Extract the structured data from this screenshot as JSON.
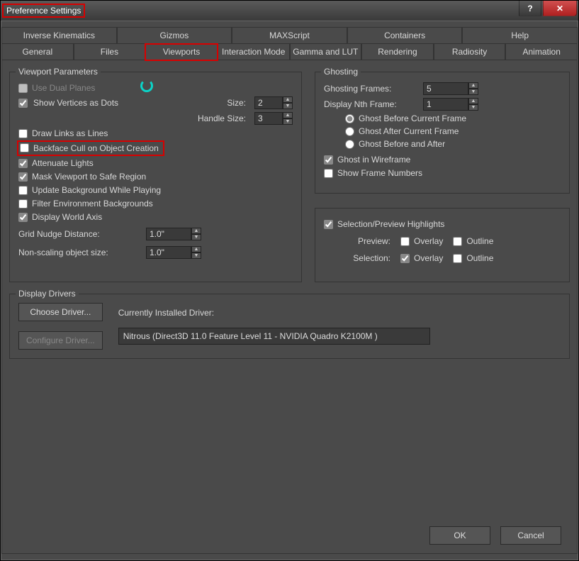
{
  "window": {
    "title": "Preference Settings"
  },
  "tabs_row1": [
    "Inverse Kinematics",
    "Gizmos",
    "MAXScript",
    "Containers",
    "Help"
  ],
  "tabs_row2": [
    "General",
    "Files",
    "Viewports",
    "Interaction Mode",
    "Gamma and LUT",
    "Rendering",
    "Radiosity",
    "Animation"
  ],
  "active_tab": "Viewports",
  "viewport_params": {
    "title": "Viewport Parameters",
    "use_dual_planes": "Use Dual Planes",
    "show_vertices": "Show Vertices as Dots",
    "size_lbl": "Size:",
    "size_val": "2",
    "handle_size_lbl": "Handle Size:",
    "handle_size_val": "3",
    "draw_links": "Draw Links as Lines",
    "backface": "Backface Cull on Object Creation",
    "attenuate": "Attenuate Lights",
    "mask": "Mask Viewport to Safe Region",
    "update_bg": "Update Background While Playing",
    "filter_env": "Filter Environment Backgrounds",
    "display_axis": "Display World Axis",
    "grid_nudge_lbl": "Grid Nudge Distance:",
    "grid_nudge_val": "1.0\"",
    "nonscale_lbl": "Non-scaling object size:",
    "nonscale_val": "1.0\""
  },
  "ghosting": {
    "title": "Ghosting",
    "frames_lbl": "Ghosting Frames:",
    "frames_val": "5",
    "nth_lbl": "Display Nth Frame:",
    "nth_val": "1",
    "before": "Ghost Before Current Frame",
    "after": "Ghost After Current Frame",
    "both": "Ghost Before and After",
    "wire": "Ghost in Wireframe",
    "numbers": "Show Frame Numbers"
  },
  "selection": {
    "title": "Selection/Preview Highlights",
    "preview_lbl": "Preview:",
    "selection_lbl": "Selection:",
    "overlay": "Overlay",
    "outline": "Outline"
  },
  "drivers": {
    "title": "Display Drivers",
    "choose": "Choose Driver...",
    "configure": "Configure Driver...",
    "installed_lbl": "Currently Installed Driver:",
    "installed_val": "Nitrous (Direct3D 11.0 Feature Level 11 - NVIDIA Quadro K2100M )"
  },
  "footer": {
    "ok": "OK",
    "cancel": "Cancel"
  }
}
